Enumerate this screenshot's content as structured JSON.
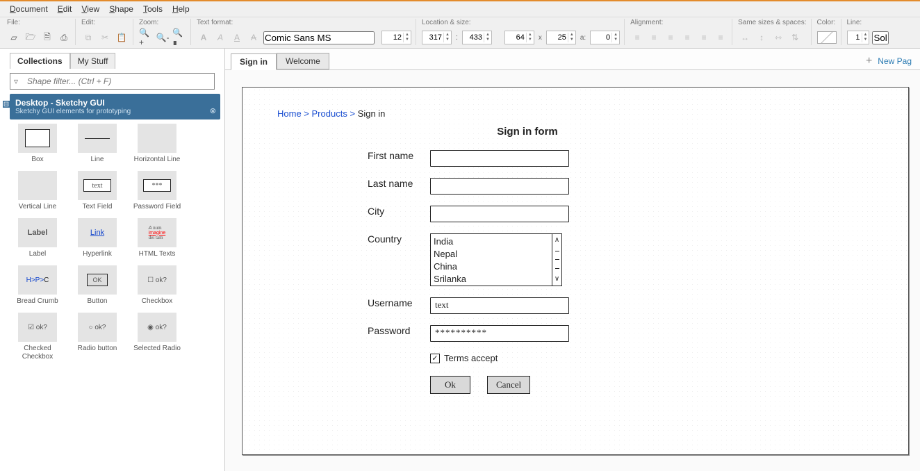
{
  "menubar": [
    "Document",
    "Edit",
    "View",
    "Shape",
    "Tools",
    "Help"
  ],
  "toolbar": {
    "file_label": "File:",
    "edit_label": "Edit:",
    "zoom_label": "Zoom:",
    "text_label": "Text format:",
    "font": "Comic Sans MS",
    "font_size": "12",
    "loc_label": "Location & size:",
    "x": "317",
    "y": "433",
    "w": "64",
    "h": "25",
    "a": "0",
    "align_label": "Alignment:",
    "same_label": "Same sizes & spaces:",
    "color_label": "Color:",
    "line_label": "Line:",
    "line_w": "1",
    "line_style": "Sol"
  },
  "left": {
    "tabs": [
      "Collections",
      "My Stuff"
    ],
    "active_tab": 0,
    "filter_placeholder": "Shape filter... (Ctrl + F)",
    "category": {
      "title": "Desktop - Sketchy GUI",
      "sub": "Sketchy GUI elements for prototyping"
    },
    "shapes": [
      {
        "name": "Box"
      },
      {
        "name": "Line"
      },
      {
        "name": "Horizontal Line"
      },
      {
        "name": "Vertical Line"
      },
      {
        "name": "Text Field"
      },
      {
        "name": "Password Field"
      },
      {
        "name": "Label"
      },
      {
        "name": "Hyperlink"
      },
      {
        "name": "HTML Texts"
      },
      {
        "name": "Bread Crumb"
      },
      {
        "name": "Button"
      },
      {
        "name": "Checkbox"
      },
      {
        "name": "Checked Checkbox"
      },
      {
        "name": "Radio button"
      },
      {
        "name": "Selected Radio"
      }
    ]
  },
  "right": {
    "tabs": [
      "Sign in",
      "Welcome"
    ],
    "active_tab": 0,
    "new_page": "New Pag"
  },
  "canvas": {
    "breadcrumb": [
      "Home",
      "Products",
      "Sign in"
    ],
    "title": "Sign in form",
    "fields": {
      "first": "First name",
      "last": "Last name",
      "city": "City",
      "country": "Country",
      "country_options": [
        "India",
        "Nepal",
        "China",
        "Srilanka"
      ],
      "username": "Username",
      "username_val": "text",
      "password": "Password",
      "password_val": "**********",
      "terms": "Terms accept",
      "ok": "Ok",
      "cancel": "Cancel"
    }
  }
}
